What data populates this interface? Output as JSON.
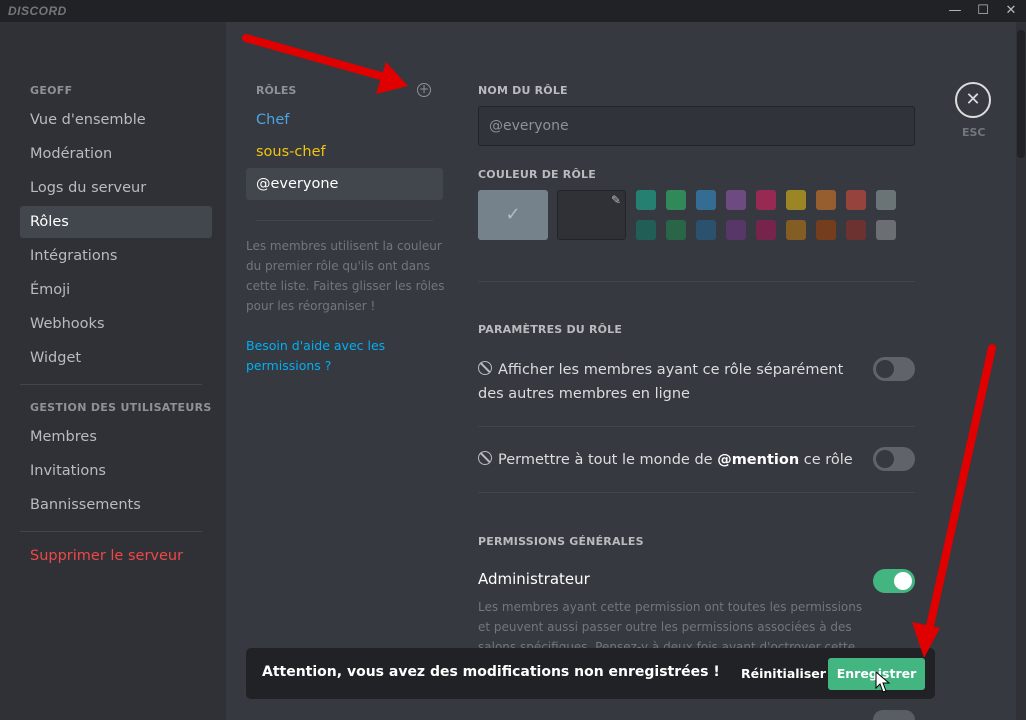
{
  "app": {
    "logo": "DISCORD"
  },
  "window_controls": {
    "minimize": "—",
    "maximize": "☐",
    "close": "✕"
  },
  "sidebar": {
    "server_header": "GEOFF",
    "server_items": [
      {
        "label": "Vue d'ensemble"
      },
      {
        "label": "Modération"
      },
      {
        "label": "Logs du serveur"
      },
      {
        "label": "Rôles",
        "active": true
      },
      {
        "label": "Intégrations"
      },
      {
        "label": "Émoji"
      },
      {
        "label": "Webhooks"
      },
      {
        "label": "Widget"
      }
    ],
    "users_header": "GESTION DES UTILISATEURS",
    "user_items": [
      {
        "label": "Membres"
      },
      {
        "label": "Invitations"
      },
      {
        "label": "Bannissements"
      }
    ],
    "delete_label": "Supprimer le serveur",
    "delete_color": "#f04747"
  },
  "roles": {
    "header": "RÔLES",
    "add_icon": "+",
    "items": [
      {
        "label": "Chef",
        "color": "#4fa3e0"
      },
      {
        "label": "sous-chef",
        "color": "#f1c40f"
      },
      {
        "label": "@everyone",
        "color": "#ffffff",
        "active": true
      }
    ],
    "help_text": "Les membres utilisent la couleur du premier rôle qu'ils ont dans cette liste. Faites glisser les rôles pour les réorganiser !",
    "help_link": "Besoin d'aide avec les permissions ?"
  },
  "editor": {
    "name_header": "NOM DU RÔLE",
    "name_value": "@everyone",
    "color_header": "COULEUR DE RÔLE",
    "default_check": "✓",
    "pipette_icon": "✎",
    "swatches_top": [
      "#1abc9c",
      "#2ecc71",
      "#3498db",
      "#9b59b6",
      "#e91e63",
      "#f1c40f",
      "#e67e22",
      "#e74c3c",
      "#95a5a6"
    ],
    "swatches_bottom": [
      "#11806a",
      "#1f8b4c",
      "#206694",
      "#71368a",
      "#ad1457",
      "#c27c0e",
      "#a84300",
      "#992d22",
      "#979c9f"
    ],
    "settings_header": "PARAMÈTRES DU RÔLE",
    "setting_hoist": "Afficher les membres ayant ce rôle séparément des autres membres en ligne",
    "setting_mention_prefix": "Permettre à tout le monde de ",
    "setting_mention_bold": "@mention",
    "setting_mention_suffix": " ce rôle",
    "perms_header": "PERMISSIONS GÉNÉRALES",
    "admin_title": "Administrateur",
    "admin_desc": "Les membres ayant cette permission ont toutes les permissions et peuvent aussi passer outre les permissions associées à des salons spécifiques. Pensez-y à deux fois avant d'octroyer cette permission, c'est",
    "admin_enabled": true
  },
  "close": {
    "icon": "✕",
    "label": "ESC"
  },
  "notice": {
    "text": "Attention, vous avez des modifications non enregistrées !",
    "reset_label": "Réinitialiser",
    "save_label": "Enregistrer",
    "save_color": "#43b581"
  }
}
